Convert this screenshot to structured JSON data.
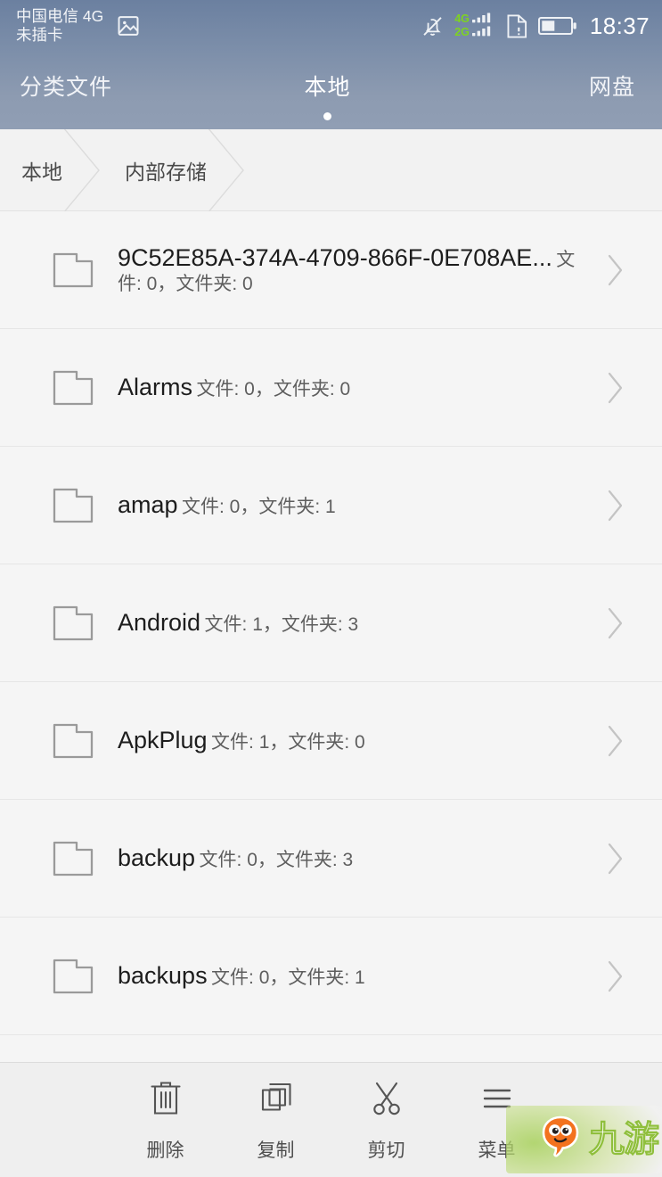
{
  "statusbar": {
    "carrier_line1": "中国电信 4G",
    "carrier_line2": "未插卡",
    "screenshot_icon": "image-icon",
    "mute_icon": "bell-muted-icon",
    "signal_4g_label": "4G",
    "signal_2g_label": "2G",
    "sim_icon": "sim-alert-icon",
    "battery_icon": "battery-half-icon",
    "clock": "18:37"
  },
  "tabs": [
    {
      "label": "分类文件",
      "active": false
    },
    {
      "label": "本地",
      "active": true
    },
    {
      "label": "网盘",
      "active": false
    }
  ],
  "breadcrumb": [
    {
      "label": "本地"
    },
    {
      "label": "内部存储"
    }
  ],
  "list": {
    "items": [
      {
        "name": "9C52E85A-374A-4709-866F-0E708AE...",
        "meta": "文件: 0，文件夹: 0"
      },
      {
        "name": "Alarms",
        "meta": "文件: 0，文件夹: 0"
      },
      {
        "name": "amap",
        "meta": "文件: 0，文件夹: 1"
      },
      {
        "name": "Android",
        "meta": "文件: 1，文件夹: 3"
      },
      {
        "name": "ApkPlug",
        "meta": "文件: 1，文件夹: 0"
      },
      {
        "name": "backup",
        "meta": "文件: 0，文件夹: 3"
      },
      {
        "name": "backups",
        "meta": "文件: 0，文件夹: 1"
      },
      {
        "name": "",
        "meta": ""
      }
    ],
    "folder_icon": "folder-icon",
    "chevron_icon": "chevron-right-icon"
  },
  "toolbar": [
    {
      "label": "删除",
      "icon": "trash-icon"
    },
    {
      "label": "复制",
      "icon": "copy-icon"
    },
    {
      "label": "剪切",
      "icon": "scissors-icon"
    },
    {
      "label": "菜单",
      "icon": "menu-icon"
    }
  ],
  "watermark": {
    "text": "九游",
    "logo_icon": "jiuyou-mascot-icon"
  },
  "colors": {
    "header_top": "#6b80a0",
    "header_bottom": "#909eb4",
    "signal_green": "#7ed321",
    "list_bg": "#f5f5f5",
    "divider": "#e6e6e6",
    "text_primary": "#1d1d1d",
    "text_secondary": "#5e5e5e",
    "toolbar_bg": "#efefef"
  }
}
